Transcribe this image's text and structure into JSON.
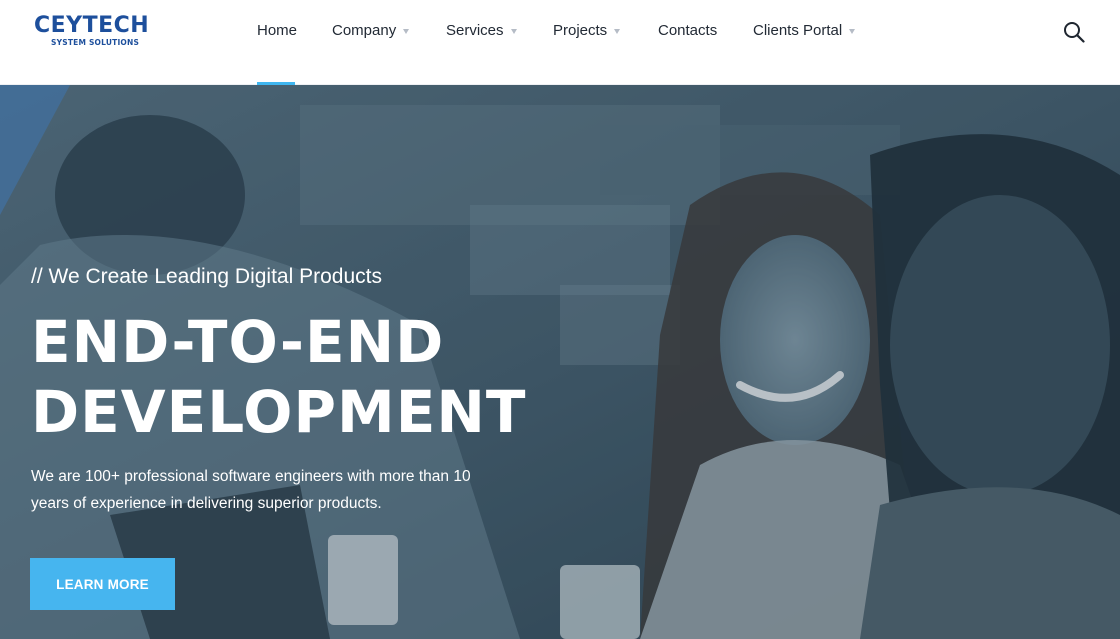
{
  "brand": {
    "name": "CEYTECH",
    "tagline": "SYSTEM SOLUTIONS",
    "color": "#1d4f9c"
  },
  "nav": {
    "items": [
      {
        "label": "Home",
        "has_dropdown": false,
        "active": true
      },
      {
        "label": "Company",
        "has_dropdown": true
      },
      {
        "label": "Services",
        "has_dropdown": true
      },
      {
        "label": "Projects",
        "has_dropdown": true
      },
      {
        "label": "Contacts",
        "has_dropdown": false
      },
      {
        "label": "Clients Portal",
        "has_dropdown": true
      }
    ],
    "active_color": "#3fb6f0",
    "search_icon": "search-icon"
  },
  "hero": {
    "kicker": "// We Create Leading Digital Products",
    "title_line1": "END-TO-END",
    "title_line2": "DEVELOPMENT",
    "description": "We are 100+ professional software engineers with more than 10 years of experience in delivering superior products.",
    "cta_label": "LEARN MORE",
    "cta_color": "#46b5ef",
    "overlay_color": "#3e5766"
  }
}
